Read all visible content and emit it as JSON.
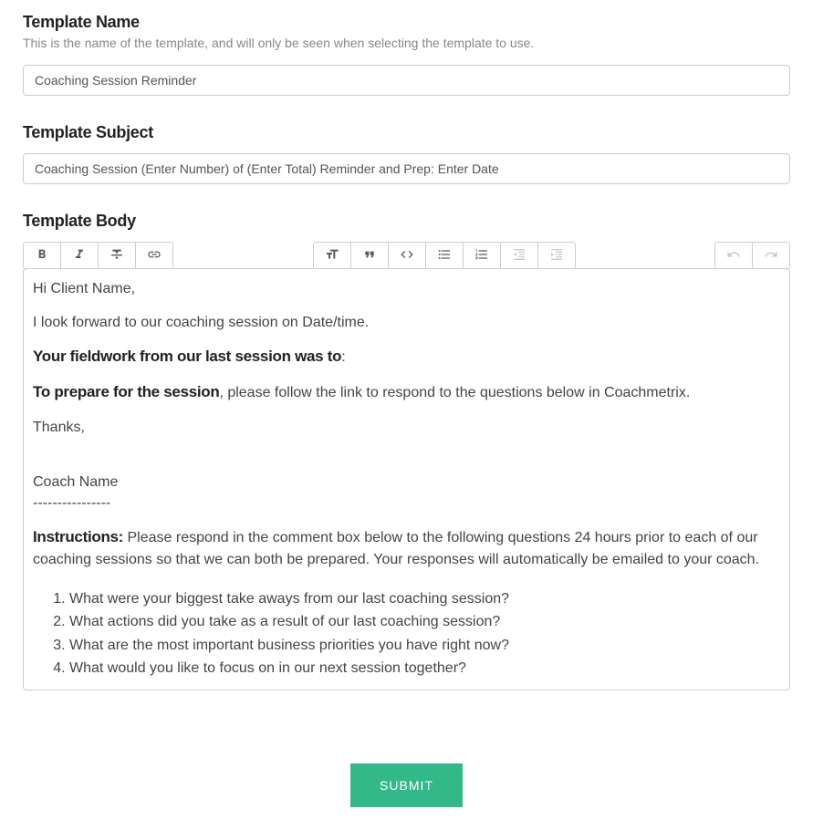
{
  "template_name": {
    "label": "Template Name",
    "description": "This is the name of the template, and will only be seen when selecting the template to use.",
    "value": "Coaching Session Reminder"
  },
  "template_subject": {
    "label": "Template Subject",
    "value": "Coaching Session (Enter Number) of (Enter Total) Reminder and Prep: Enter Date"
  },
  "template_body": {
    "label": "Template Body",
    "content": {
      "greeting": "Hi Client Name,",
      "intro": "I look forward to our coaching session on Date/time.",
      "fieldwork_label": "Your fieldwork from our last session was to",
      "fieldwork_colon": ":",
      "prepare_label": "To prepare for the session",
      "prepare_text": ", please follow the link to respond to the questions below in Coachmetrix.",
      "thanks": "Thanks,",
      "coach": "Coach Name",
      "divider": "----------------",
      "instructions_label": "Instructions:",
      "instructions_text": "  Please respond in the comment box below to the following questions 24 hours prior to each of our coaching sessions so that we can both be prepared. Your responses will automatically be emailed to your coach.",
      "questions": [
        "What were your biggest take aways from our last coaching session?",
        "What actions did you take as a result of our last coaching session?",
        "What are the most important business priorities you have right now?",
        "What would you like to focus on in our next session together?"
      ]
    }
  },
  "submit_label": "SUBMIT"
}
